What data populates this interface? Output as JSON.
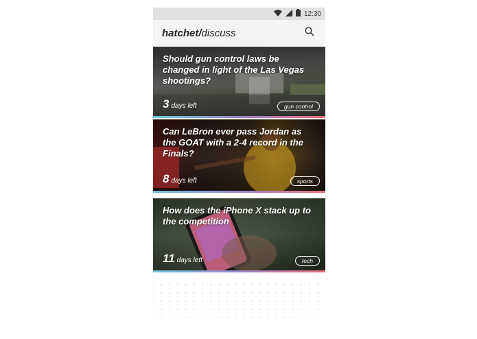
{
  "status_bar": {
    "time": "12:30"
  },
  "app_bar": {
    "brand_bold": "hatchet",
    "brand_sep": "/",
    "brand_light": "discuss"
  },
  "cards": [
    {
      "title": "Should gun control laws be changed in light of the Las Vegas shootings?",
      "days": "3",
      "days_label": "days left",
      "tag": "gun control"
    },
    {
      "title": "Can LeBron ever pass Jordan as the GOAT with a 2-4 record in the Finals?",
      "days": "8",
      "days_label": "days left",
      "tag": "sports"
    },
    {
      "title": "How does the iPhone X stack up to the competition",
      "days": "11",
      "days_label": "days left",
      "tag": "tech"
    }
  ],
  "colors": {
    "stripe_start": "#6ec6dc",
    "stripe_mid": "#9a86c9",
    "stripe_end": "#e8707a",
    "status_bar_bg": "#e0e0e0",
    "app_bar_bg": "#f4f4f4"
  }
}
